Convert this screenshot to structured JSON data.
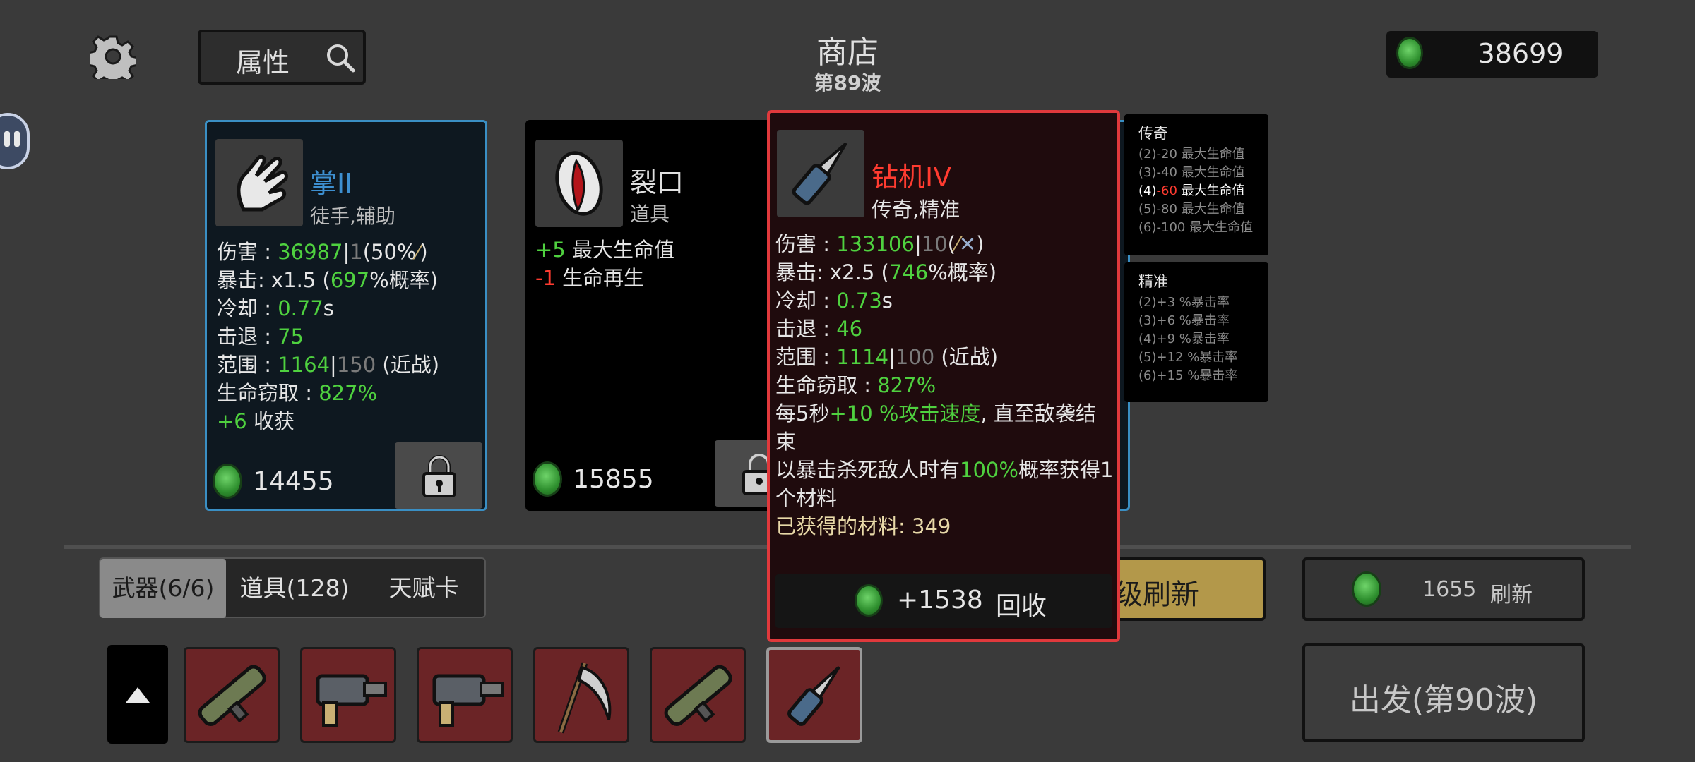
{
  "header": {
    "title": "商店",
    "wave": "第89波",
    "attributes_label": "属性",
    "coins": "38699"
  },
  "cards": [
    {
      "name": "掌II",
      "tags": "徒手,辅助",
      "stats": [
        {
          "label": "伤害 : ",
          "value": "36987",
          "sep": "|",
          "base": "1",
          "extra": "(50%",
          "tail": ")"
        },
        {
          "label": "暴击:  x1.5 (",
          "value": "697",
          "extra": "%概率)"
        },
        {
          "label": "冷却 : ",
          "value": "0.77",
          "extra": "s"
        },
        {
          "label": "击退 : ",
          "value": "75"
        },
        {
          "label": "范围 : ",
          "value": "1164",
          "sep": "|",
          "base": "150",
          "extra": " (近战)"
        },
        {
          "label": "生命窃取 : ",
          "value": "827%"
        },
        {
          "value": "+6",
          "extra": " 收获"
        }
      ],
      "price": "14455"
    },
    {
      "name": "裂口",
      "tags": "道具",
      "stats": [
        {
          "value": "+5",
          "extra": " 最大生命值"
        },
        {
          "value": "-1",
          "extra": " 生命再生"
        }
      ],
      "price": "15855"
    }
  ],
  "detail": {
    "name": "钻机IV",
    "tags": "传奇,精准",
    "damage_label": "伤害 : ",
    "damage_value": "133106",
    "damage_base": "10",
    "damage_open": "(",
    "damage_close": ")",
    "crit_label": "暴击:  x2.5 (",
    "crit_value": "746",
    "crit_tail": "%概率)",
    "cooldown_label": "冷却 : ",
    "cooldown_value": "0.73",
    "cooldown_unit": "s",
    "knockback_label": "击退 : ",
    "knockback_value": "46",
    "range_label": "范围 : ",
    "range_value": "1114",
    "range_base": "100",
    "range_tail": " (近战)",
    "lifesteal_label": "生命窃取 : ",
    "lifesteal_value": "827%",
    "effect1_a": "每5秒",
    "effect1_b": "+10 %攻击速度",
    "effect1_c": ", 直至敌袭结束",
    "effect2_a": "以暴击杀死敌人时有",
    "effect2_b": "100%",
    "effect2_c": "概率获得1个材料",
    "effect3": "已获得的材料:  349",
    "sell_amount": "+1538",
    "sell_label": "回收"
  },
  "sets": [
    {
      "title": "传奇",
      "lines": [
        "(2)-20 最大生命值",
        "(3)-40 最大生命值"
      ],
      "active_prefix": "(4)",
      "active_value": "-60",
      "active_suffix": " 最大生命值",
      "lines_after": [
        "(5)-80 最大生命值",
        "(6)-100 最大生命值"
      ]
    },
    {
      "title": "精准",
      "lines": [
        "(2)+3 %暴击率",
        "(3)+6 %暴击率",
        "(4)+9 %暴击率",
        "(5)+12 %暴击率",
        "(6)+15 %暴击率"
      ]
    }
  ],
  "tabs": {
    "weapons": "武器(6/6)",
    "items": "道具(128)",
    "talents": "天赋卡"
  },
  "buttons": {
    "upgrade_refresh_partial": "级刷新",
    "refresh_cost": "1655",
    "refresh_label": "刷新",
    "go": "出发(第90波)"
  },
  "colors": {
    "background": "#3a3a3a",
    "detail_border": "#e0393c",
    "card_border_blue": "#3a8fc4",
    "accent_green": "#4fd13f",
    "gold_button": "#b3984a"
  },
  "icons": [
    "gear-icon",
    "search-icon",
    "pause-icon",
    "lock-icon",
    "coin-icon",
    "up-arrow-icon"
  ]
}
